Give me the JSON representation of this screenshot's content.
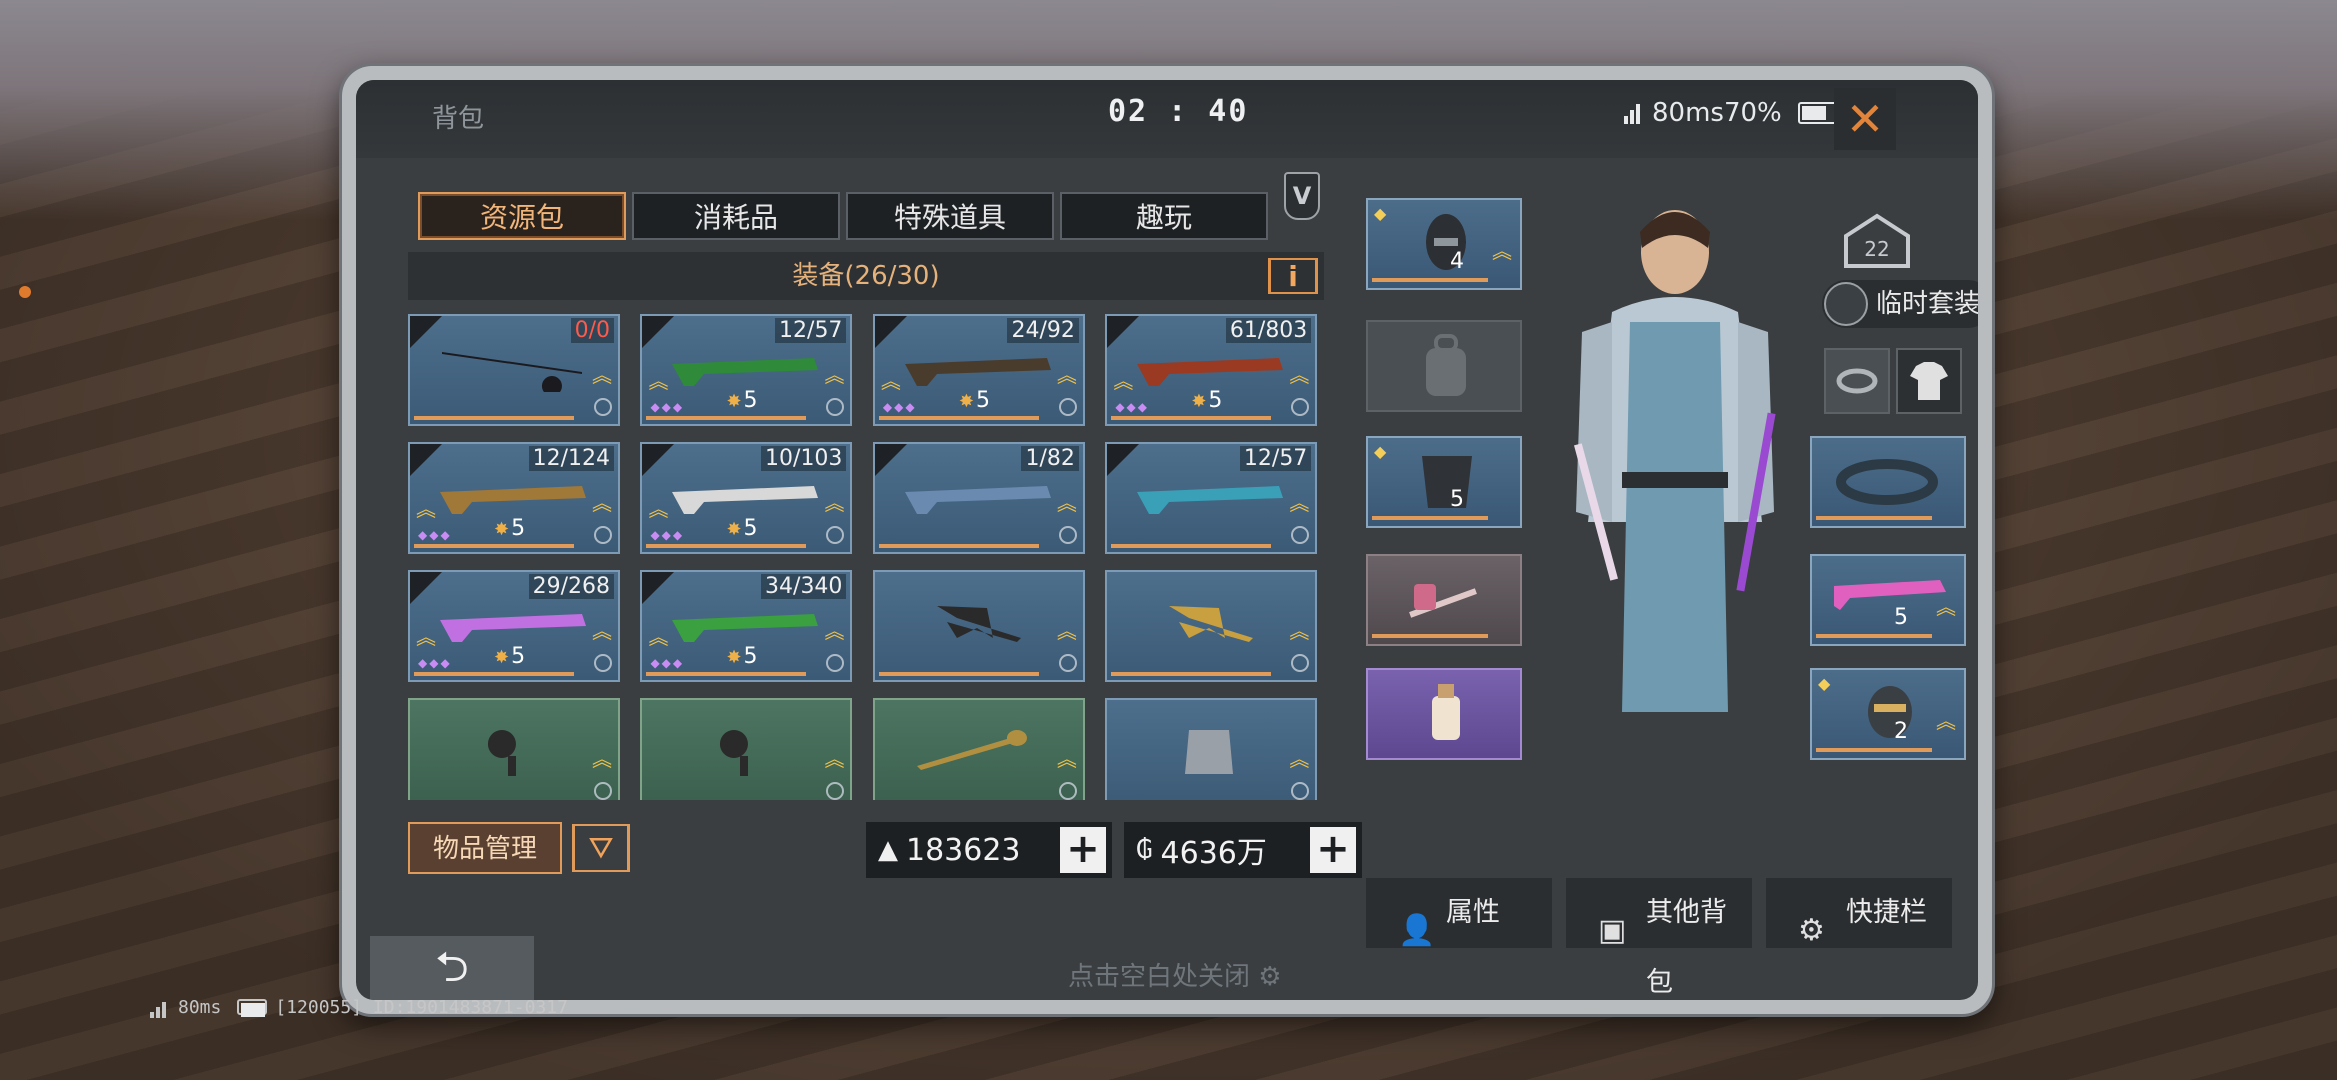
{
  "header": {
    "title": "背包",
    "time": "02 : 40",
    "status_text": "80ms70%"
  },
  "tabs": [
    {
      "label": "资源包"
    },
    {
      "label": "消耗品"
    },
    {
      "label": "特殊道具"
    },
    {
      "label": "趣玩"
    }
  ],
  "v_badge": "V",
  "equip_title": "装备(26/30)",
  "info_label": "i",
  "items": [
    {
      "count": "0/0",
      "stars": "",
      "kind": "fishing-rod-icon"
    },
    {
      "count": "12/57",
      "stars": "5",
      "kind": "rifle-icon"
    },
    {
      "count": "24/92",
      "stars": "5",
      "kind": "rifle-icon"
    },
    {
      "count": "61/803",
      "stars": "5",
      "kind": "rifle-icon"
    },
    {
      "count": "12/124",
      "stars": "5",
      "kind": "crossbow-icon"
    },
    {
      "count": "10/103",
      "stars": "5",
      "kind": "crossbow-icon"
    },
    {
      "count": "1/82",
      "stars": "",
      "kind": "crossbow-icon"
    },
    {
      "count": "12/57",
      "stars": "",
      "kind": "rifle-icon"
    },
    {
      "count": "29/268",
      "stars": "5",
      "kind": "rifle-icon"
    },
    {
      "count": "34/340",
      "stars": "5",
      "kind": "rifle-icon"
    },
    {
      "count": "",
      "stars": "",
      "kind": "axe-icon"
    },
    {
      "count": "",
      "stars": "",
      "kind": "pickaxe-icon"
    },
    {
      "count": "",
      "stars": "",
      "kind": "fan-icon"
    },
    {
      "count": "",
      "stars": "",
      "kind": "fan-icon"
    },
    {
      "count": "",
      "stars": "",
      "kind": "shovel-icon"
    },
    {
      "count": "",
      "stars": "",
      "kind": "armor-icon"
    }
  ],
  "manage_label": "物品管理",
  "filter_label": "Y",
  "currency": {
    "resource": "183623",
    "coins": "4636万",
    "plus": "+"
  },
  "right": {
    "level": "22",
    "suit_label": "临时套装",
    "helmet_stars": "4",
    "armor_stars": "5",
    "weapon_stars": "5",
    "head_stars": "2"
  },
  "actions": [
    {
      "label": "属性"
    },
    {
      "label": "其他背包"
    },
    {
      "label": "快捷栏"
    }
  ],
  "back_label": "⮌",
  "hint": "点击空白处关闭",
  "footer": {
    "ping": "80ms",
    "id_text": "[120055] ID:1901483871-0317"
  },
  "colors": {
    "accent": "#e09a5a",
    "tile_blue": "#4d6f8c",
    "tile_green": "#4d7562",
    "count_red": "#ff5a4a"
  }
}
